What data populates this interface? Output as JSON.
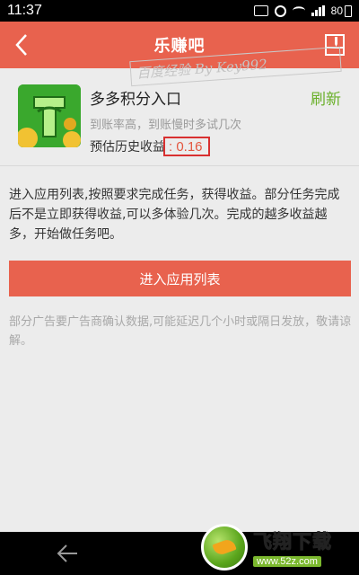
{
  "status_bar": {
    "time": "11:37",
    "battery": "80",
    "icons": [
      "image-icon",
      "alarm-icon",
      "wifi-icon",
      "signal-icon",
      "battery-icon"
    ]
  },
  "header": {
    "title": "乐赚吧",
    "back_icon": "back-arrow-icon",
    "action_icon": "pencil-icon",
    "background_color": "#e8624e"
  },
  "watermark": {
    "text": "百度经验 By Key992"
  },
  "app": {
    "name": "多多积分入口",
    "description": "到账率高，到账慢时多试几次",
    "earnings_label": "预估历史收益",
    "earnings_value": ": 0.16",
    "refresh_label": "刷新",
    "refresh_color": "#6ab02a"
  },
  "intro_text": "进入应用列表,按照要求完成任务，获得收益。部分任务完成后不是立即获得收益,可以多体验几次。完成的越多收益越多，开始做任务吧。",
  "enter_button_label": "进入应用列表",
  "notice_text": "部分广告要广告商确认数据,可能延迟几个小时或隔日发放，敬请谅解。",
  "nav": {
    "back_icon": "nav-back-icon"
  },
  "site_logo": {
    "name": "飞翔下载",
    "url": "www.52z.com"
  }
}
